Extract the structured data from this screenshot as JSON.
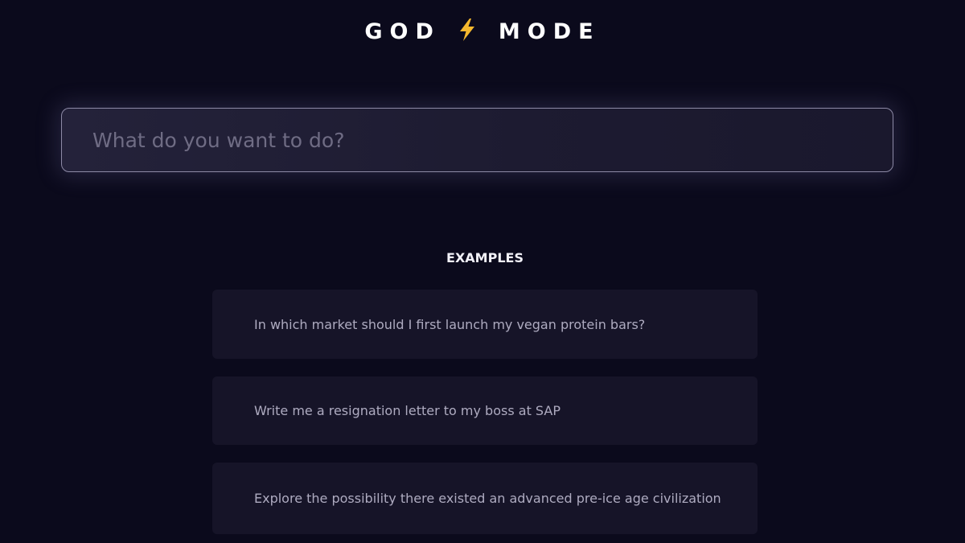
{
  "header": {
    "logo_left": "GOD",
    "logo_icon": "lightning-bolt-icon",
    "logo_right": "MODE",
    "bolt_color": "#f5b82e"
  },
  "search": {
    "placeholder": "What do you want to do?",
    "value": ""
  },
  "examples": {
    "heading": "EXAMPLES",
    "items": [
      {
        "label": "In which market should I first launch my vegan protein bars?"
      },
      {
        "label": "Write me a resignation letter to my boss at SAP"
      },
      {
        "label": "Explore the possibility there existed an advanced pre-ice age civilization"
      }
    ]
  },
  "colors": {
    "background": "#0b0a1c",
    "card": "#161428",
    "input_border": "#8d8aa6",
    "text_muted": "#aeabc0"
  }
}
